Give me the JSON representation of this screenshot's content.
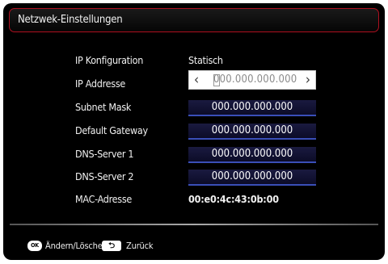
{
  "title": "Netzwek-Einstellungen",
  "rows": [
    {
      "label": "IP Konfiguration",
      "value": "Statisch"
    },
    {
      "label": "IP Addresse",
      "value": "000.000.000.000",
      "editing_digit": "0"
    },
    {
      "label": "Subnet Mask",
      "value": "000.000.000.000"
    },
    {
      "label": "Default Gateway",
      "value": "000.000.000.000"
    },
    {
      "label": "DNS-Server 1",
      "value": "000.000.000.000"
    },
    {
      "label": "DNS-Server 2",
      "value": "000.000.000.000"
    },
    {
      "label": "MAC-Adresse",
      "value": "00:e0:4c:43:0b:00"
    }
  ],
  "footer": {
    "ok_key": "OK",
    "ok_label": "Ändern/Löschen",
    "back_label": "Zurück"
  },
  "colors": {
    "frame_border": "#b01020",
    "field_underline": "#3a4fb8"
  }
}
